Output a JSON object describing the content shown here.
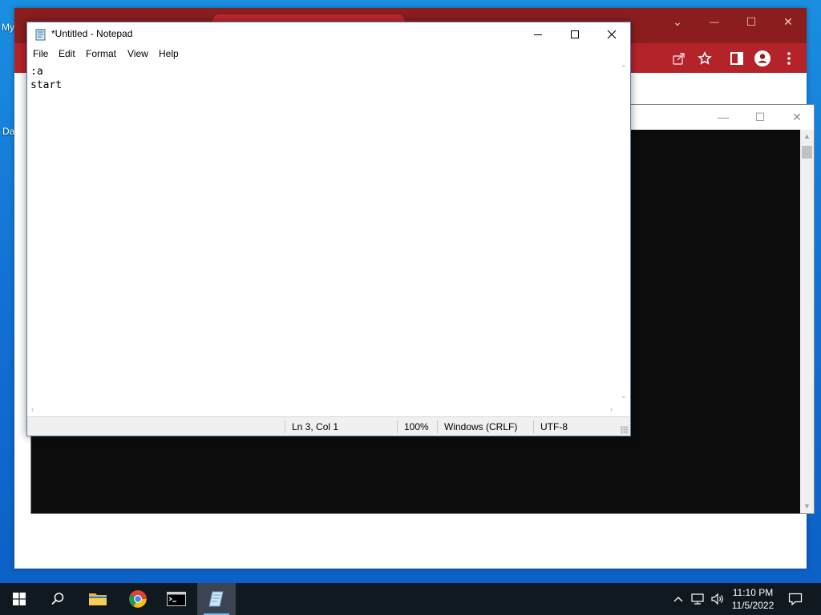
{
  "desktop": {
    "label_my": "My",
    "label_da": "Da"
  },
  "chrome": {
    "controls": {
      "tab_search": "⌄",
      "minimize": "—",
      "maximize": "☐",
      "close": "✕"
    },
    "toolbar_icons": [
      "share-icon",
      "star-icon",
      "sidepanel-icon",
      "profile-icon",
      "menu-icon"
    ]
  },
  "console": {
    "controls": {
      "minimize": "—",
      "maximize": "☐",
      "close": "✕"
    }
  },
  "notepad": {
    "title": "*Untitled - Notepad",
    "menu": [
      "File",
      "Edit",
      "Format",
      "View",
      "Help"
    ],
    "content": ":a\nstart",
    "status": {
      "position": "Ln 3, Col 1",
      "zoom": "100%",
      "line_ending": "Windows (CRLF)",
      "encoding": "UTF-8"
    }
  },
  "taskbar": {
    "apps": [
      "start-icon",
      "search-icon",
      "file-explorer-icon",
      "chrome-icon",
      "command-prompt-icon",
      "notepad-icon"
    ],
    "active_app": "notepad",
    "clock": {
      "time": "11:10 PM",
      "date": "11/5/2022"
    }
  },
  "colors": {
    "chrome_frame": "#8b1d1e",
    "chrome_toolbar": "#b5232a",
    "taskbar": "#101820",
    "desktop": "#1173d4"
  }
}
